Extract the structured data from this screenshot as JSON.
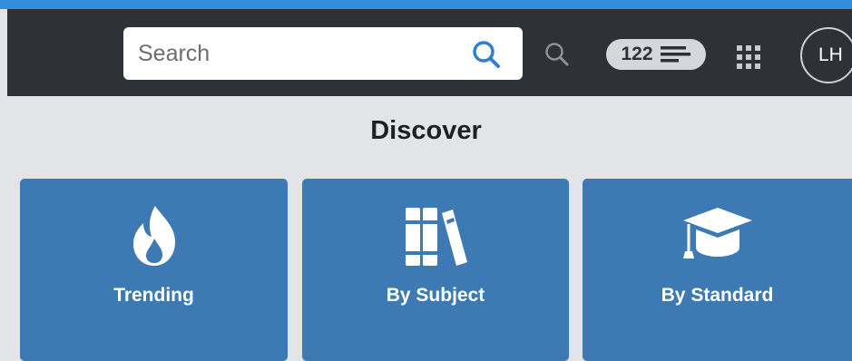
{
  "search": {
    "placeholder": "Search"
  },
  "header": {
    "count_badge": "122",
    "avatar_initials": "LH"
  },
  "main": {
    "title": "Discover",
    "tiles": [
      {
        "label": "Trending",
        "icon": "fire-icon"
      },
      {
        "label": "By Subject",
        "icon": "books-icon"
      },
      {
        "label": "By Standard",
        "icon": "graduation-cap-icon"
      }
    ]
  },
  "colors": {
    "top_stripe": "#2f8fdc",
    "navbar": "#2e3136",
    "tile": "#3d79b3",
    "search_icon": "#2f7fd1"
  }
}
